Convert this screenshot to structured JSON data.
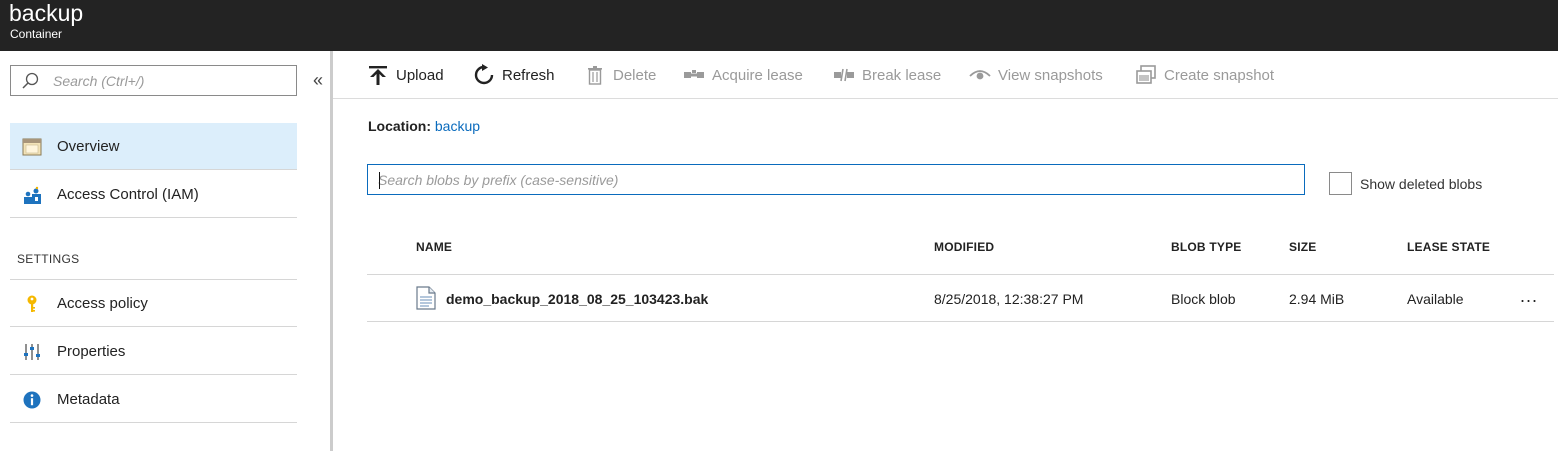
{
  "header": {
    "title": "backup",
    "subtitle": "Container"
  },
  "sidebar": {
    "search_placeholder": "Search (Ctrl+/)",
    "collapse_label": "«",
    "items_top": [
      {
        "label": "Overview",
        "icon": "overview-icon",
        "active": true
      },
      {
        "label": "Access Control (IAM)",
        "icon": "access-control-icon",
        "active": false
      }
    ],
    "section_label": "SETTINGS",
    "items_settings": [
      {
        "label": "Access policy",
        "icon": "key-icon"
      },
      {
        "label": "Properties",
        "icon": "properties-icon"
      },
      {
        "label": "Metadata",
        "icon": "info-icon"
      }
    ]
  },
  "toolbar": {
    "upload": "Upload",
    "refresh": "Refresh",
    "delete": "Delete",
    "acquire_lease": "Acquire lease",
    "break_lease": "Break lease",
    "view_snapshots": "View snapshots",
    "create_snapshot": "Create snapshot"
  },
  "location": {
    "label": "Location:",
    "value": "backup"
  },
  "blob_search": {
    "placeholder": "Search blobs by prefix (case-sensitive)",
    "value": ""
  },
  "show_deleted": {
    "label": "Show deleted blobs",
    "checked": false
  },
  "table": {
    "columns": [
      "NAME",
      "MODIFIED",
      "BLOB TYPE",
      "SIZE",
      "LEASE STATE"
    ],
    "rows": [
      {
        "name": "demo_backup_2018_08_25_103423.bak",
        "modified": "8/25/2018, 12:38:27 PM",
        "blob_type": "Block blob",
        "size": "2.94 MiB",
        "lease_state": "Available",
        "more": "..."
      }
    ]
  },
  "colors": {
    "header_bg": "#232323",
    "active_nav_bg": "#dceefb",
    "link_blue": "#0a6bbd",
    "disabled_text": "#9a9a9a"
  }
}
